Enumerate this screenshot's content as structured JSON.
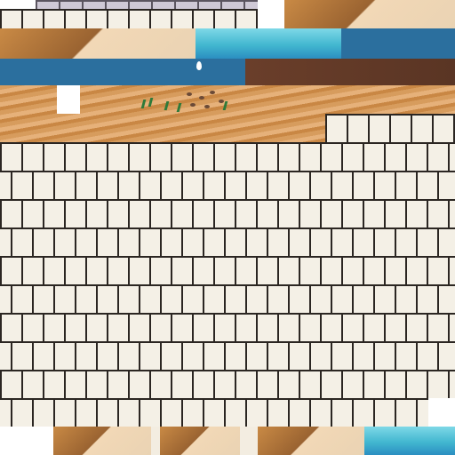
{
  "scene": {
    "kind": "tile-texture-collage",
    "colors": {
      "brick": "#f4f0e6",
      "mortar": "#2b2622",
      "sand": "#d79c5d",
      "water": "#42b7d0",
      "deep_water": "#2b6f9e",
      "rock": "#9a6331",
      "grey_stone": "#cfc9d6"
    },
    "tiles": [
      {
        "name": "grey-stone-strip",
        "icon": "stone-wall-icon"
      },
      {
        "name": "rock-cliff",
        "icon": "cliff-icon"
      },
      {
        "name": "water-band",
        "icon": "water-icon"
      },
      {
        "name": "sand-ground",
        "icon": "sand-icon"
      },
      {
        "name": "white-brick-wall",
        "icon": "brick-wall-icon"
      }
    ]
  }
}
